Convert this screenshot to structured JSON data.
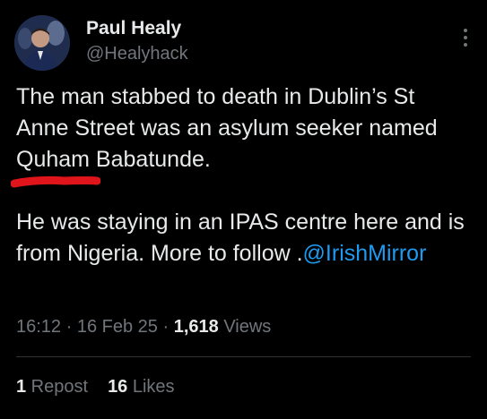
{
  "author": {
    "name": "Paul Healy",
    "handle": "@Healyhack"
  },
  "tweet": {
    "line1": "The man stabbed to death in Dublin’s St Anne Street was an asylum seeker named ",
    "highlighted_name": "Quham",
    "line1_end": " Babatunde.",
    "para2": "He was staying in an IPAS centre here and is from Nigeria. More to follow .",
    "mention": "@IrishMirror"
  },
  "meta": {
    "time": "16:12",
    "sep1": " · ",
    "date": "16 Feb 25",
    "sep2": " · ",
    "views_count": "1,618",
    "views_label": " Views"
  },
  "stats": {
    "reposts_count": "1",
    "reposts_label": " Repost",
    "likes_count": "16",
    "likes_label": " Likes"
  },
  "colors": {
    "background": "#000000",
    "text": "#e7e9ea",
    "muted": "#71767b",
    "link": "#1d9bf0",
    "annotation_red": "#e0141b"
  },
  "icons": {
    "more": "more-vertical-icon"
  }
}
